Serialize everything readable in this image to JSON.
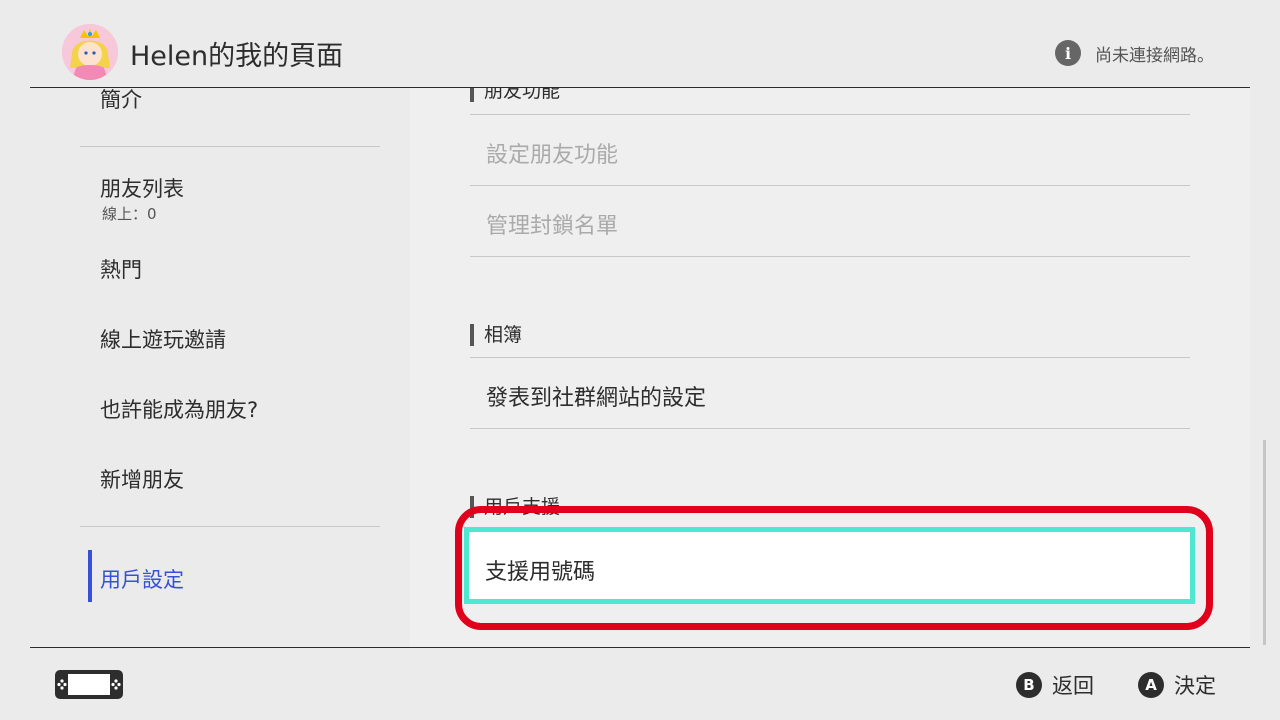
{
  "header": {
    "title": "Helen的我的頁面",
    "network_status": "尚未連接網路。",
    "info_icon": "i"
  },
  "sidebar": {
    "items": [
      {
        "label": "簡介"
      },
      {
        "label": "朋友列表",
        "sub": "線上：0"
      },
      {
        "label": "熱門"
      },
      {
        "label": "線上遊玩邀請"
      },
      {
        "label": "也許能成為朋友?"
      },
      {
        "label": "新增朋友"
      },
      {
        "label": "用戶設定",
        "active": true
      }
    ]
  },
  "main": {
    "sections": [
      {
        "heading": "朋友功能",
        "items": [
          "設定朋友功能",
          "管理封鎖名單"
        ]
      },
      {
        "heading": "相簿",
        "items": [
          "發表到社群網站的設定"
        ]
      },
      {
        "heading": "用戶支援",
        "items": [
          "支援用號碼"
        ]
      }
    ]
  },
  "footer": {
    "back": {
      "key": "B",
      "label": "返回"
    },
    "confirm": {
      "key": "A",
      "label": "決定"
    }
  },
  "colors": {
    "accent": "#3451d8",
    "selection_border": "#4fe6d2",
    "highlight_ring": "#e0001b"
  }
}
